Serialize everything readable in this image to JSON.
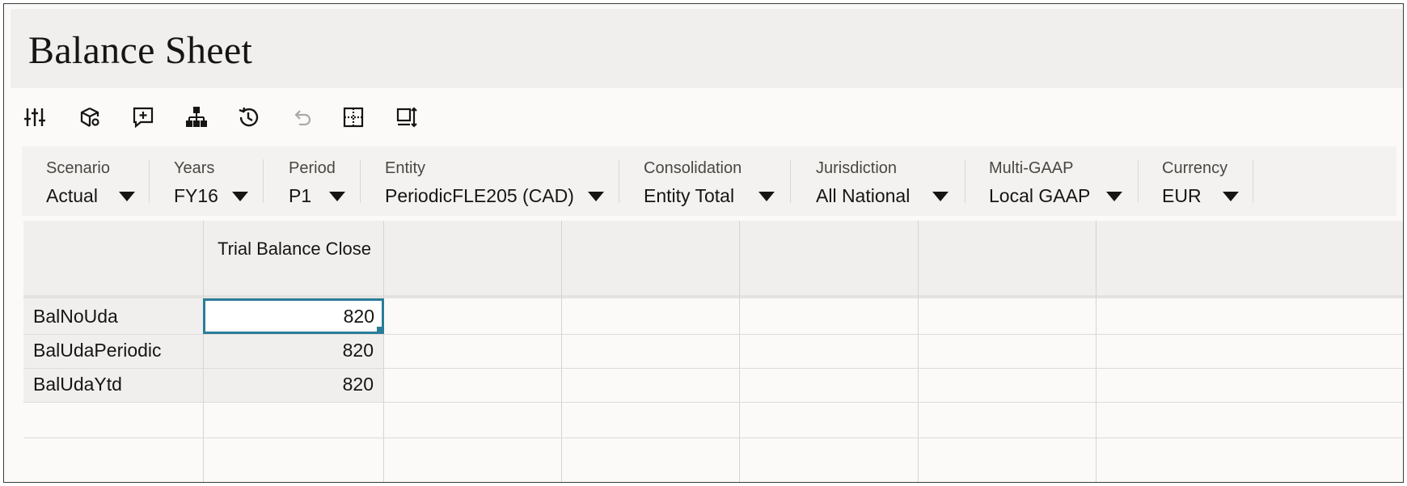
{
  "page": {
    "title": "Balance Sheet"
  },
  "toolbar": {
    "buttons": [
      {
        "icon": "adjust-sliders-icon",
        "enabled": true
      },
      {
        "icon": "cube-settings-icon",
        "enabled": true
      },
      {
        "icon": "add-comment-icon",
        "enabled": true
      },
      {
        "icon": "hierarchy-icon",
        "enabled": true
      },
      {
        "icon": "history-icon",
        "enabled": true
      },
      {
        "icon": "undo-icon",
        "enabled": false
      },
      {
        "icon": "grid-cell-icon",
        "enabled": true
      },
      {
        "icon": "column-insert-icon",
        "enabled": true
      }
    ]
  },
  "pov": [
    {
      "label": "Scenario",
      "value": "Actual"
    },
    {
      "label": "Years",
      "value": "FY16"
    },
    {
      "label": "Period",
      "value": "P1"
    },
    {
      "label": "Entity",
      "value": "PeriodicFLE205 (CAD)"
    },
    {
      "label": "Consolidation",
      "value": "Entity Total"
    },
    {
      "label": "Jurisdiction",
      "value": "All National"
    },
    {
      "label": "Multi-GAAP",
      "value": "Local GAAP"
    },
    {
      "label": "Currency",
      "value": "EUR"
    }
  ],
  "grid": {
    "column_header": "Trial Balance Close",
    "rows": [
      {
        "label": "BalNoUda",
        "value": "820"
      },
      {
        "label": "BalUdaPeriodic",
        "value": "820"
      },
      {
        "label": "BalUdaYtd",
        "value": "820"
      }
    ]
  },
  "colors": {
    "accent": "#2a7d99",
    "header_bg": "#f1efed"
  }
}
